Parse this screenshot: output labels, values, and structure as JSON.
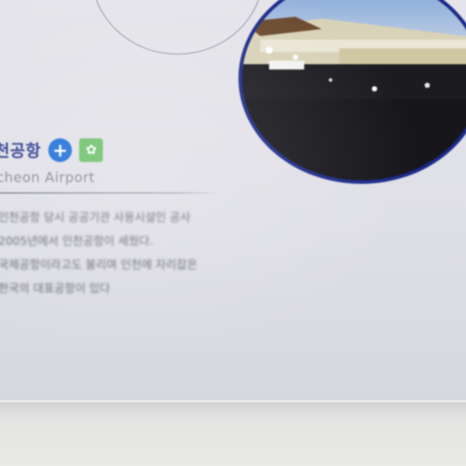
{
  "sign": {
    "title": "천공항",
    "subtitle": "cheon Airport",
    "body_lines": [
      "인천공항 당시 공공기관 사용시설인 공사",
      "2005년에서 인천공항이 세웠다.",
      "국제공항이라고도 불리며 인천에 자리잡은",
      "한국의 대표공항이 있다"
    ],
    "icons": {
      "plus": "plus-circle-icon",
      "green": "green-square-icon"
    }
  },
  "colors": {
    "accent_blue": "#1e6fd8",
    "title_navy": "#2c3a8e",
    "photo_ring": "#1c2a8a",
    "icon_green": "#6cc06a",
    "board": "#e4e4ea"
  }
}
